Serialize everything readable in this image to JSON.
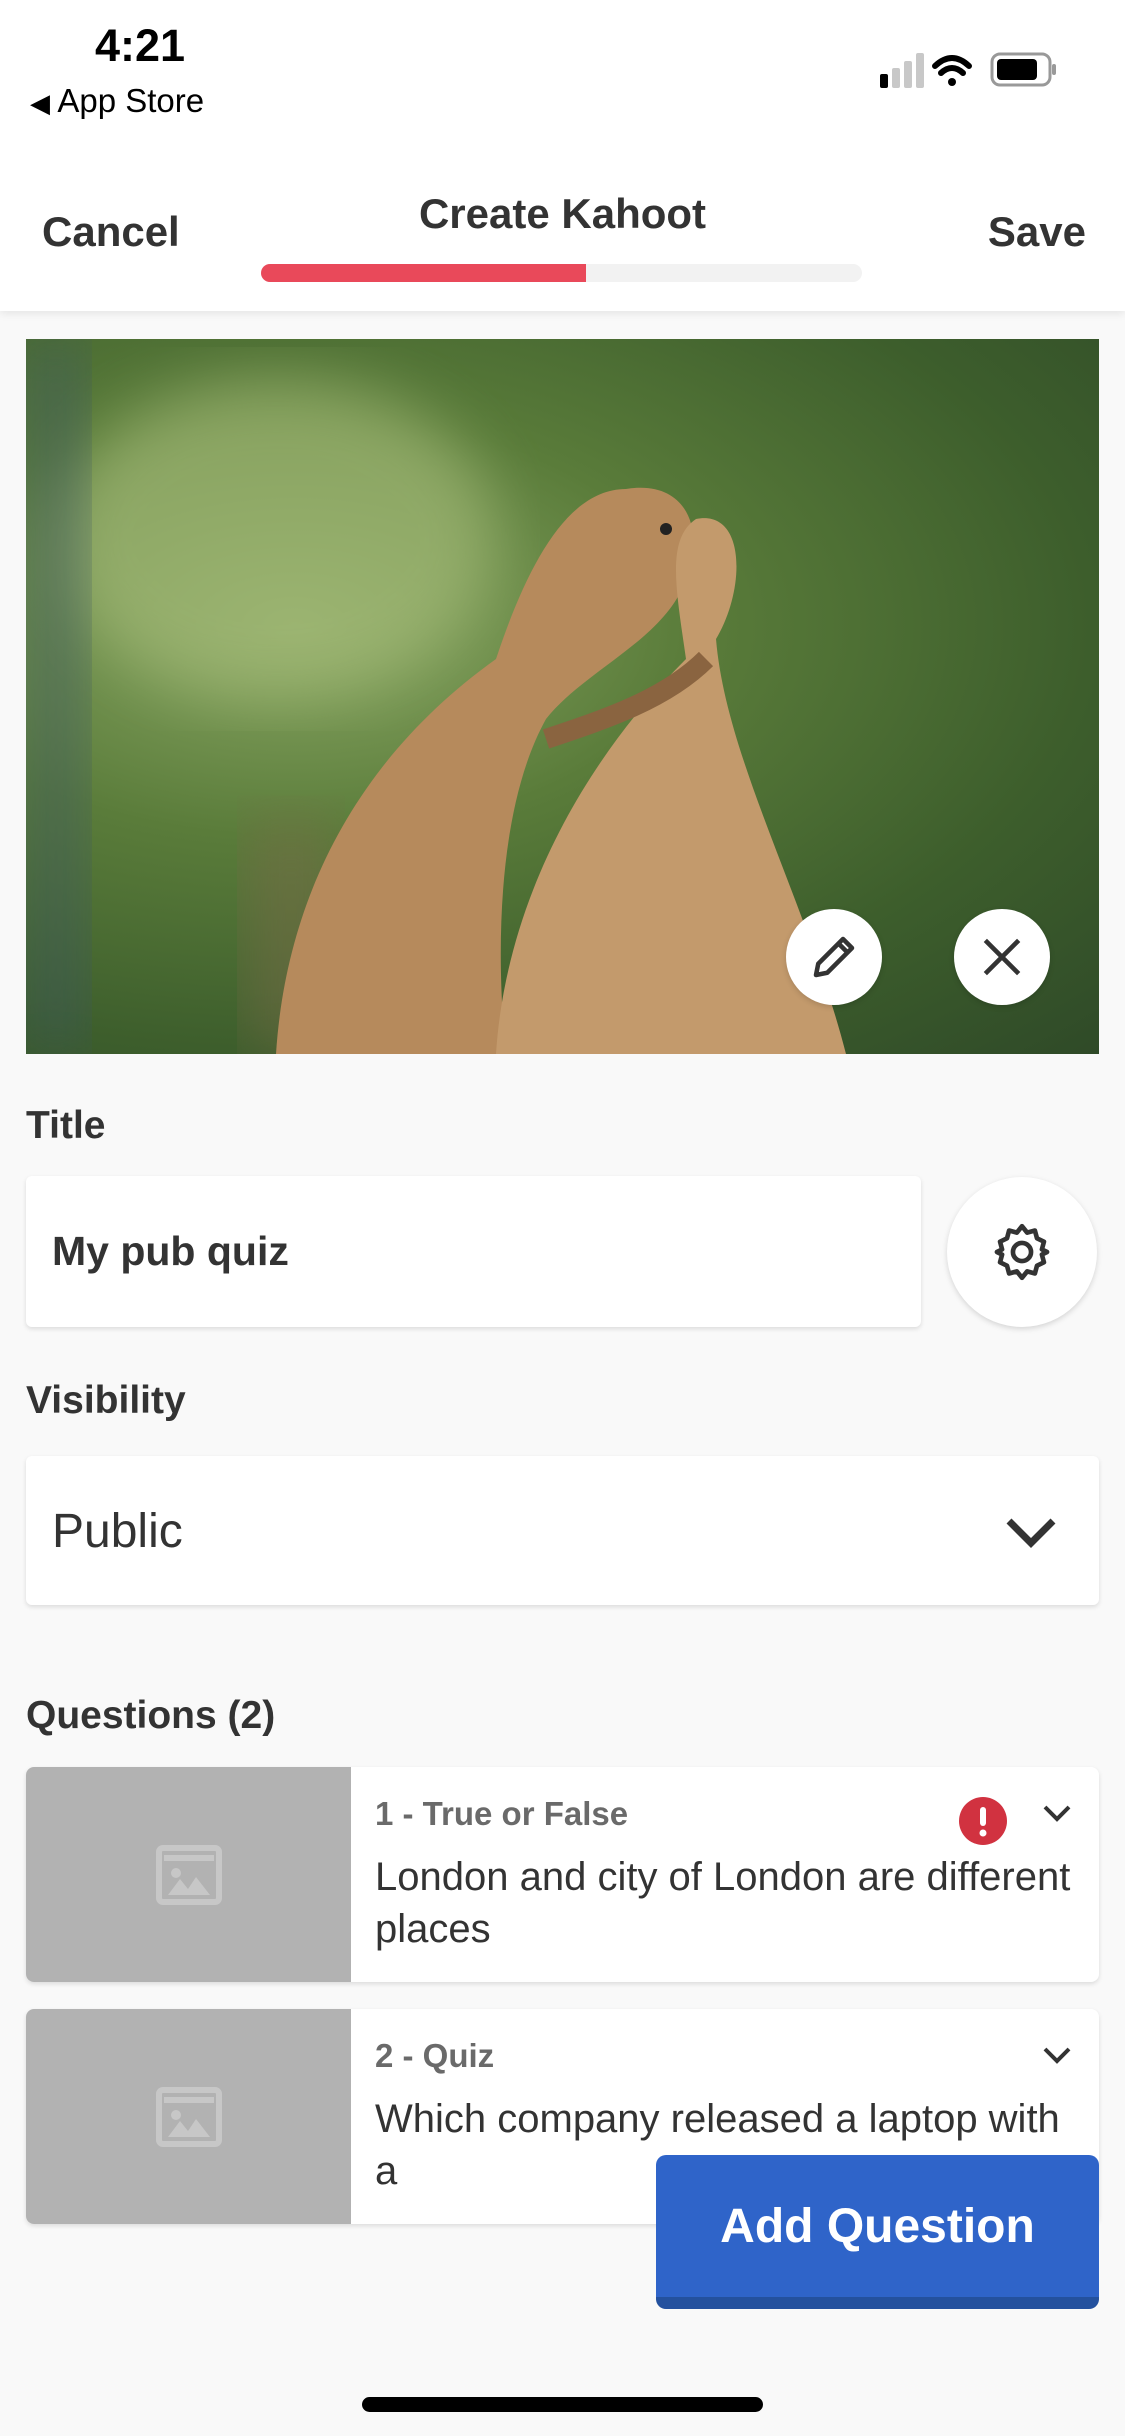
{
  "status_bar": {
    "time": "4:21",
    "back_label": "App Store"
  },
  "nav": {
    "cancel": "Cancel",
    "title": "Create Kahoot",
    "save": "Save",
    "progress_percent": 54,
    "progress_color": "#e9495a"
  },
  "cover_image": {
    "alt": "two prairie dogs hugging",
    "edit_icon": "pencil-icon",
    "remove_icon": "close-icon"
  },
  "title_section": {
    "label": "Title",
    "value": "My pub quiz",
    "settings_icon": "gear-icon"
  },
  "visibility": {
    "label": "Visibility",
    "selected": "Public"
  },
  "questions": {
    "header": "Questions (2)",
    "items": [
      {
        "type": "1 - True or False",
        "text": "London and city of London are different places",
        "error": true
      },
      {
        "type": "2 - Quiz",
        "text": "Which company released a laptop with a",
        "error": false
      }
    ]
  },
  "add_question": {
    "label": "Add Question",
    "color": "#2f64c9"
  }
}
